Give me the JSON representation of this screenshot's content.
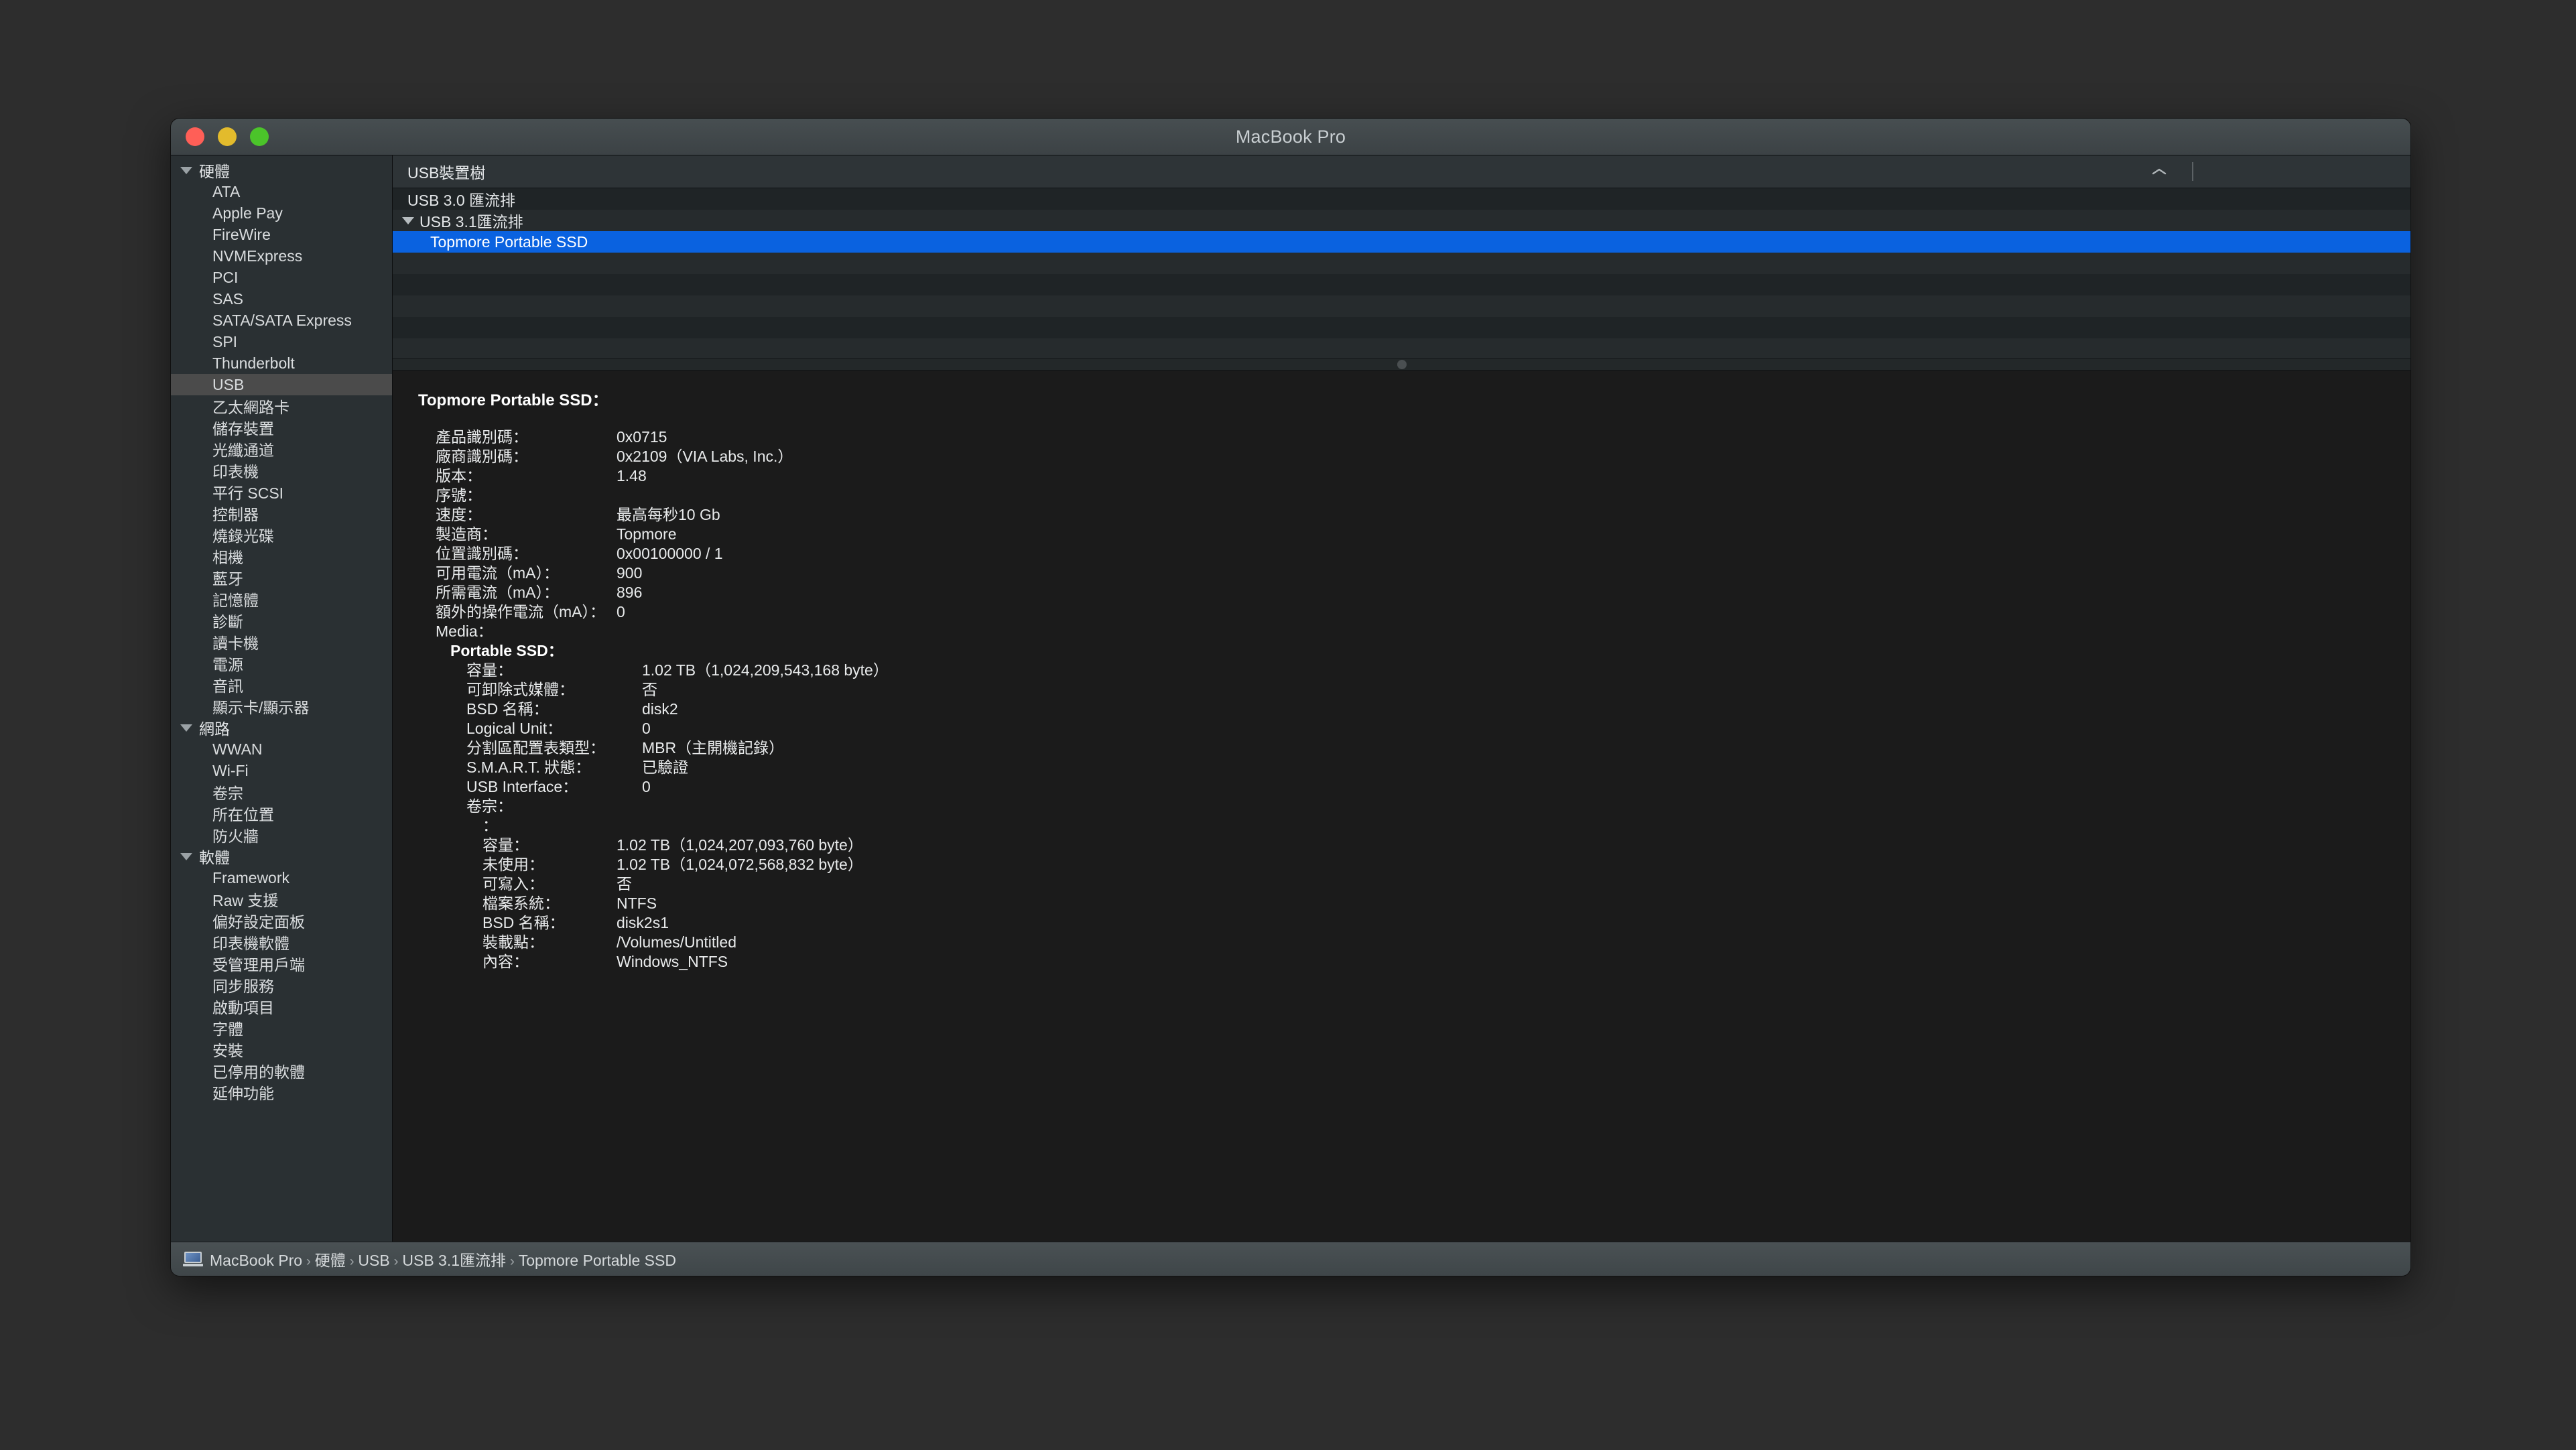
{
  "window": {
    "title": "MacBook Pro",
    "traffic_lights": [
      {
        "name": "close",
        "color": "#ff5f57"
      },
      {
        "name": "minimize",
        "color": "#e3bb2c"
      },
      {
        "name": "maximize",
        "color": "#4bc42a"
      }
    ]
  },
  "sidebar": {
    "groups": [
      {
        "label": "硬體",
        "items": [
          "ATA",
          "Apple Pay",
          "FireWire",
          "NVMExpress",
          "PCI",
          "SAS",
          "SATA/SATA Express",
          "SPI",
          "Thunderbolt",
          "USB",
          "乙太網路卡",
          "儲存裝置",
          "光纖通道",
          "印表機",
          "平行 SCSI",
          "控制器",
          "燒錄光碟",
          "相機",
          "藍牙",
          "記憶體",
          "診斷",
          "讀卡機",
          "電源",
          "音訊",
          "顯示卡/顯示器"
        ]
      },
      {
        "label": "網路",
        "items": [
          "WWAN",
          "Wi-Fi",
          "卷宗",
          "所在位置",
          "防火牆"
        ]
      },
      {
        "label": "軟體",
        "items": [
          "Framework",
          "Raw 支援",
          "偏好設定面板",
          "印表機軟體",
          "受管理用戶端",
          "同步服務",
          "啟動項目",
          "字體",
          "安裝",
          "已停用的軟體",
          "延伸功能"
        ]
      }
    ],
    "selected": "USB"
  },
  "tree": {
    "column_header": "USB裝置樹",
    "sort_direction": "ascending",
    "rows": [
      {
        "label": "USB 3.0 匯流排",
        "indent": 1,
        "twisty": false,
        "selected": false
      },
      {
        "label": "USB 3.1匯流排",
        "indent": 1,
        "twisty": true,
        "selected": false
      },
      {
        "label": "Topmore Portable SSD",
        "indent": 2,
        "twisty": false,
        "selected": true
      }
    ],
    "empty_rows": 5
  },
  "detail": {
    "title": "Topmore Portable SSD：",
    "rows": [
      {
        "level": 1,
        "key": "產品識別碼：",
        "value": "0x0715",
        "kw": "kw-a"
      },
      {
        "level": 1,
        "key": "廠商識別碼：",
        "value": "0x2109（VIA Labs, Inc.）",
        "kw": "kw-a"
      },
      {
        "level": 1,
        "key": "版本：",
        "value": "1.48",
        "kw": "kw-a"
      },
      {
        "level": 1,
        "key": "序號：",
        "value": "",
        "kw": "kw-a"
      },
      {
        "level": 1,
        "key": "速度：",
        "value": "最高每秒10 Gb",
        "kw": "kw-a"
      },
      {
        "level": 1,
        "key": "製造商：",
        "value": "Topmore",
        "kw": "kw-a"
      },
      {
        "level": 1,
        "key": "位置識別碼：",
        "value": "0x00100000 / 1",
        "kw": "kw-a"
      },
      {
        "level": 1,
        "key": "可用電流（mA）：",
        "value": "900",
        "kw": "kw-a"
      },
      {
        "level": 1,
        "key": "所需電流（mA）：",
        "value": "896",
        "kw": "kw-a"
      },
      {
        "level": 1,
        "key": "額外的操作電流（mA）：",
        "value": "0",
        "kw": "kw-a"
      },
      {
        "level": 1,
        "key": "Media：",
        "value": "",
        "kw": "kw-a"
      },
      {
        "level": 2,
        "key": "Portable SSD：",
        "value": "",
        "kw": "kw-auto",
        "bold": true
      },
      {
        "level": 3,
        "key": "容量：",
        "value": "1.02 TB（1,024,209,543,168 byte）",
        "kw": "kw-b"
      },
      {
        "level": 3,
        "key": "可卸除式媒體：",
        "value": "否",
        "kw": "kw-b"
      },
      {
        "level": 3,
        "key": "BSD 名稱：",
        "value": "disk2",
        "kw": "kw-b"
      },
      {
        "level": 3,
        "key": "Logical Unit：",
        "value": "0",
        "kw": "kw-b"
      },
      {
        "level": 3,
        "key": "分割區配置表類型：",
        "value": "MBR（主開機記錄）",
        "kw": "kw-b"
      },
      {
        "level": 3,
        "key": "S.M.A.R.T. 狀態：",
        "value": "已驗證",
        "kw": "kw-b"
      },
      {
        "level": 3,
        "key": "USB Interface：",
        "value": "0",
        "kw": "kw-b"
      },
      {
        "level": 3,
        "key": "卷宗：",
        "value": "",
        "kw": "kw-b"
      },
      {
        "level": 4,
        "key": "：",
        "value": "",
        "kw": "kw-auto"
      },
      {
        "level": 4,
        "key": "容量：",
        "value": "1.02 TB（1,024,207,093,760 byte）",
        "kw": "kw-c"
      },
      {
        "level": 4,
        "key": "未使用：",
        "value": "1.02 TB（1,024,072,568,832 byte）",
        "kw": "kw-c"
      },
      {
        "level": 4,
        "key": "可寫入：",
        "value": "否",
        "kw": "kw-c"
      },
      {
        "level": 4,
        "key": "檔案系統：",
        "value": "NTFS",
        "kw": "kw-c"
      },
      {
        "level": 4,
        "key": "BSD 名稱：",
        "value": "disk2s1",
        "kw": "kw-c"
      },
      {
        "level": 4,
        "key": "裝載點：",
        "value": "/Volumes/Untitled",
        "kw": "kw-c"
      },
      {
        "level": 4,
        "key": "內容：",
        "value": "Windows_NTFS",
        "kw": "kw-c"
      }
    ]
  },
  "statusbar": {
    "icon": "macbook-icon",
    "separator": "›",
    "breadcrumb": [
      "MacBook Pro",
      "硬體",
      "USB",
      "USB 3.1匯流排",
      "Topmore Portable SSD"
    ]
  }
}
